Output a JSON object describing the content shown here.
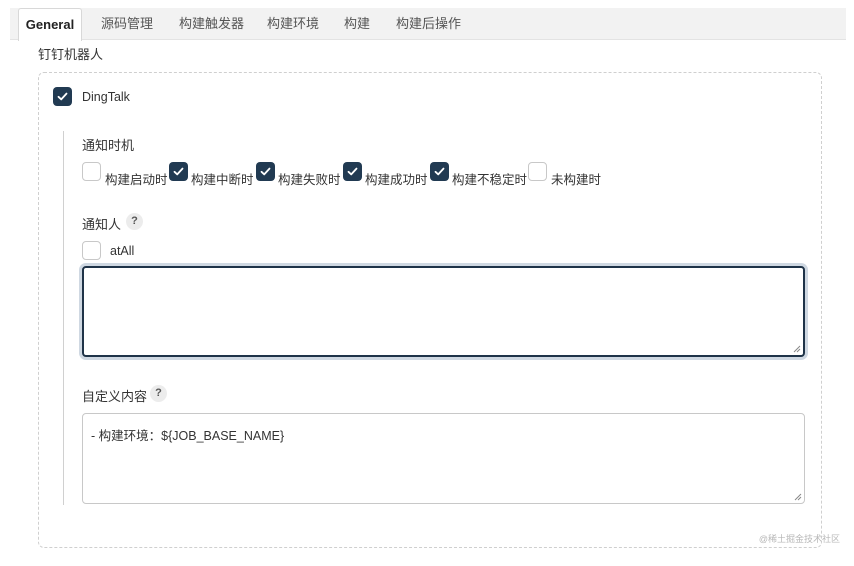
{
  "tabs": [
    {
      "label": "General",
      "active": true
    },
    {
      "label": "源码管理",
      "active": false
    },
    {
      "label": "构建触发器",
      "active": false
    },
    {
      "label": "构建环境",
      "active": false
    },
    {
      "label": "构建",
      "active": false
    },
    {
      "label": "构建后操作",
      "active": false
    }
  ],
  "section_title": "钉钉机器人",
  "plugin": {
    "label": "DingTalk",
    "checked": true
  },
  "notify_timing": {
    "title": "通知时机",
    "options": [
      {
        "label": "构建启动时",
        "checked": false
      },
      {
        "label": "构建中断时",
        "checked": true
      },
      {
        "label": "构建失败时",
        "checked": true
      },
      {
        "label": "构建成功时",
        "checked": true
      },
      {
        "label": "构建不稳定时",
        "checked": true
      },
      {
        "label": "未构建时",
        "checked": false
      }
    ]
  },
  "notify_people": {
    "title": "通知人",
    "help": "?",
    "at_all_label": "atAll",
    "at_all_checked": false,
    "value": ""
  },
  "custom_content": {
    "title": "自定义内容",
    "help": "?",
    "value": "- 构建环境：${JOB_BASE_NAME}"
  },
  "watermark": "@稀土掘金技术社区",
  "colors": {
    "checkbox_checked": "#213a52",
    "focus_border": "#1f3348"
  }
}
